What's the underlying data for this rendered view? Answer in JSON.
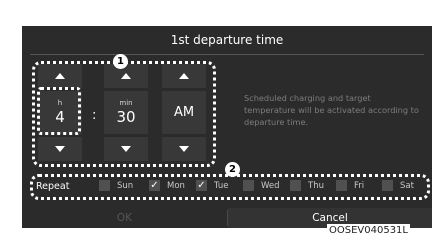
{
  "dialog": {
    "title": "1st departure time"
  },
  "time": {
    "hour_unit": "h",
    "hour_value": "4",
    "separator": ":",
    "minute_unit": "min",
    "minute_value": "30",
    "period": "AM"
  },
  "callouts": {
    "one": "1",
    "two": "2"
  },
  "info_text": "Scheduled charging and target temperature will be activated according to departure time.",
  "repeat": {
    "label": "Repeat",
    "days": [
      {
        "label": "Sun",
        "mark": ""
      },
      {
        "label": "Mon",
        "mark": "✓"
      },
      {
        "label": "Tue",
        "mark": "✓"
      },
      {
        "label": "Wed",
        "mark": ""
      },
      {
        "label": "Thu",
        "mark": ""
      },
      {
        "label": "Fri",
        "mark": ""
      },
      {
        "label": "Sat",
        "mark": ""
      }
    ]
  },
  "buttons": {
    "ok": "OK",
    "cancel": "Cancel"
  },
  "figure_code": "OOSEV040531L"
}
